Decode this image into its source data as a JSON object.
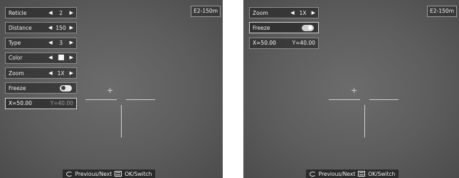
{
  "left_panel": {
    "model_badge": "E2-150m",
    "menu": [
      {
        "label": "Reticle",
        "value": "2"
      },
      {
        "label": "Distance",
        "value": "150"
      },
      {
        "label": "Type",
        "value": "3"
      },
      {
        "label": "Color",
        "value_icon": "white-square-swatch"
      },
      {
        "label": "Zoom",
        "value": "1X"
      },
      {
        "label": "Freeze",
        "toggle": "off"
      }
    ],
    "coords": {
      "x": "X=50.00",
      "y": "Y=40.00"
    },
    "footer": {
      "prev_next": "Previous/Next",
      "ok_switch": "OK/Switch"
    }
  },
  "right_panel": {
    "model_badge": "E2-150m",
    "menu": [
      {
        "label": "Zoom",
        "value": "1X"
      },
      {
        "label": "Freeze",
        "toggle": "on"
      }
    ],
    "coords": {
      "x": "X=50.00",
      "y": "Y=40.00"
    },
    "footer": {
      "prev_next": "Previous/Next",
      "ok_switch": "OK/Switch"
    }
  },
  "colors": {
    "screen_bg": "#5d5d5d",
    "text": "#ffffff",
    "footer_bg": "#2b2b2b"
  },
  "icons": {
    "arrow_left": "◀",
    "arrow_right": "▶",
    "plus": "+"
  }
}
